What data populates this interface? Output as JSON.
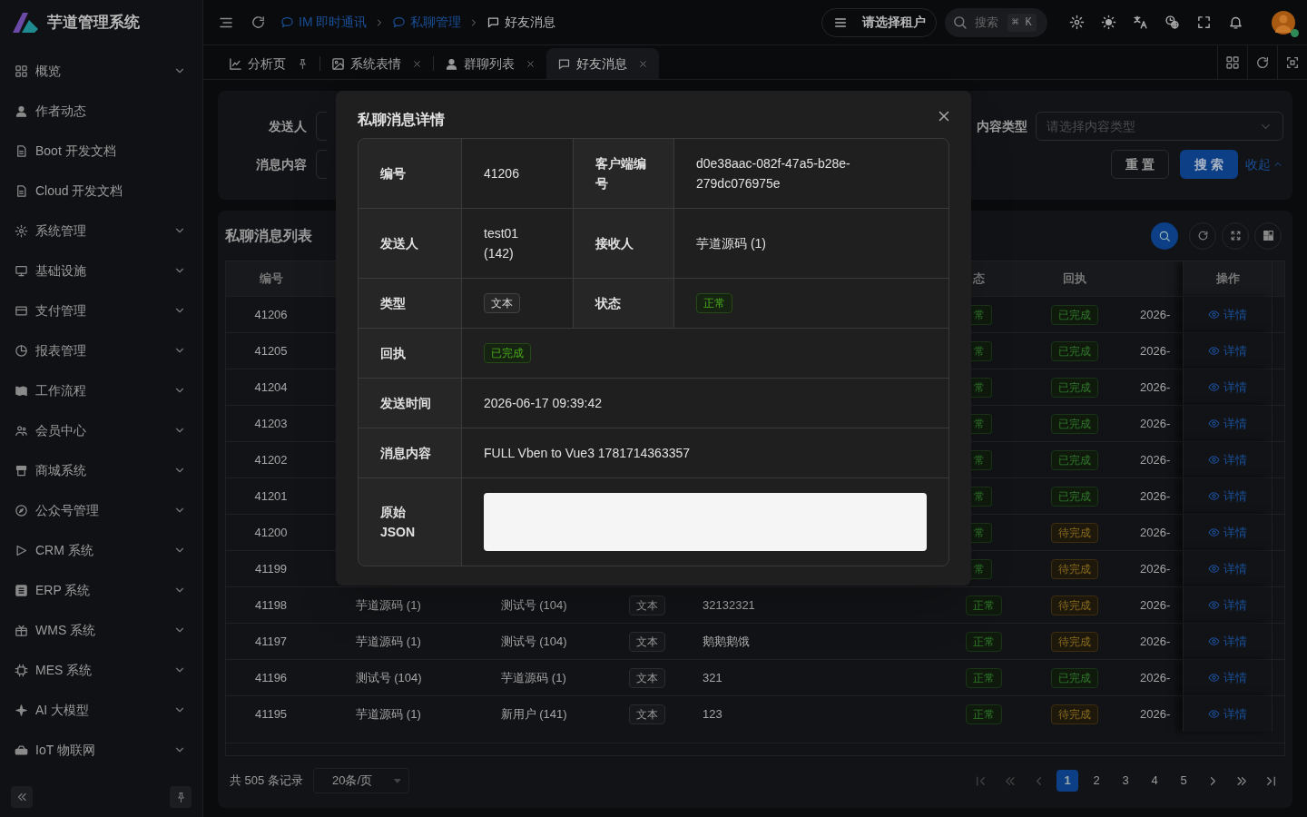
{
  "app": {
    "title": "芋道管理系统"
  },
  "sidebar": {
    "items": [
      {
        "label": "概览",
        "has_children": true
      },
      {
        "label": "作者动态",
        "has_children": false
      },
      {
        "label": "Boot 开发文档",
        "has_children": false
      },
      {
        "label": "Cloud 开发文档",
        "has_children": false
      },
      {
        "label": "系统管理",
        "has_children": true
      },
      {
        "label": "基础设施",
        "has_children": true
      },
      {
        "label": "支付管理",
        "has_children": true
      },
      {
        "label": "报表管理",
        "has_children": true
      },
      {
        "label": "工作流程",
        "has_children": true
      },
      {
        "label": "会员中心",
        "has_children": true
      },
      {
        "label": "商城系统",
        "has_children": true
      },
      {
        "label": "公众号管理",
        "has_children": true
      },
      {
        "label": "CRM 系统",
        "has_children": true
      },
      {
        "label": "ERP 系统",
        "has_children": true
      },
      {
        "label": "WMS 系统",
        "has_children": true
      },
      {
        "label": "MES 系统",
        "has_children": true
      },
      {
        "label": "AI 大模型",
        "has_children": true
      },
      {
        "label": "IoT 物联网",
        "has_children": true
      }
    ]
  },
  "header": {
    "breadcrumb": [
      {
        "label": "IM 即时通讯",
        "current": false
      },
      {
        "label": "私聊管理",
        "current": false
      },
      {
        "label": "好友消息",
        "current": true
      }
    ],
    "tenant_select": {
      "placeholder": "请选择租户"
    },
    "search": {
      "placeholder": "搜索",
      "shortcut": "⌘ K"
    }
  },
  "tabs": [
    {
      "label": "分析页",
      "selected": false,
      "pinned": true
    },
    {
      "label": "系统表情",
      "selected": false,
      "pinned": false
    },
    {
      "label": "群聊列表",
      "selected": false,
      "pinned": false
    },
    {
      "label": "好友消息",
      "selected": true,
      "pinned": false
    }
  ],
  "search_form": {
    "fields": [
      {
        "label": "发送人"
      },
      {
        "label": "消息内容"
      },
      {
        "label": "内容类型",
        "placeholder": "请选择内容类型"
      }
    ],
    "buttons": [
      "重 置",
      "搜 索"
    ],
    "collapse_link": "收起"
  },
  "table": {
    "title": "私聊消息列表",
    "columns": {
      "id": "编号",
      "status": "态",
      "receipt": "回执",
      "action": "操作"
    },
    "rows": [
      {
        "id": "41206",
        "status": {
          "text": "常",
          "kind": "success",
          "clipped": true
        },
        "receipt": {
          "text": "已完成",
          "kind": "success"
        },
        "time": "2026-",
        "action": "详情"
      },
      {
        "id": "41205",
        "status": {
          "text": "常",
          "kind": "success",
          "clipped": true
        },
        "receipt": {
          "text": "已完成",
          "kind": "success"
        },
        "time": "2026-",
        "action": "详情"
      },
      {
        "id": "41204",
        "status": {
          "text": "常",
          "kind": "success",
          "clipped": true
        },
        "receipt": {
          "text": "已完成",
          "kind": "success"
        },
        "time": "2026-",
        "action": "详情"
      },
      {
        "id": "41203",
        "status": {
          "text": "常",
          "kind": "success",
          "clipped": true
        },
        "receipt": {
          "text": "已完成",
          "kind": "success"
        },
        "time": "2026-",
        "action": "详情"
      },
      {
        "id": "41202",
        "status": {
          "text": "常",
          "kind": "success",
          "clipped": true
        },
        "receipt": {
          "text": "已完成",
          "kind": "success"
        },
        "time": "2026-",
        "action": "详情"
      },
      {
        "id": "41201",
        "status": {
          "text": "常",
          "kind": "success",
          "clipped": true
        },
        "receipt": {
          "text": "已完成",
          "kind": "success"
        },
        "time": "2026-",
        "action": "详情"
      },
      {
        "id": "41200",
        "status": {
          "text": "常",
          "kind": "success",
          "clipped": true
        },
        "receipt": {
          "text": "待完成",
          "kind": "warning"
        },
        "time": "2026-",
        "action": "详情"
      },
      {
        "id": "41199",
        "status": {
          "text": "常",
          "kind": "success",
          "clipped": true
        },
        "receipt": {
          "text": "待完成",
          "kind": "warning"
        },
        "time": "2026-",
        "action": "详情"
      },
      {
        "id": "41198",
        "sender": "芋道源码 (1)",
        "receiver": "测试号 (104)",
        "type": "文本",
        "content": "32132321",
        "status": {
          "text": "正常",
          "kind": "success",
          "clipped": false
        },
        "receipt": {
          "text": "待完成",
          "kind": "warning"
        },
        "time": "2026-",
        "action": "详情"
      },
      {
        "id": "41197",
        "sender": "芋道源码 (1)",
        "receiver": "测试号 (104)",
        "type": "文本",
        "content": "鹅鹅鹅饿",
        "status": {
          "text": "正常",
          "kind": "success",
          "clipped": false
        },
        "receipt": {
          "text": "待完成",
          "kind": "warning"
        },
        "time": "2026-",
        "action": "详情"
      },
      {
        "id": "41196",
        "sender": "测试号 (104)",
        "receiver": "芋道源码 (1)",
        "type": "文本",
        "content": "321",
        "status": {
          "text": "正常",
          "kind": "success",
          "clipped": false
        },
        "receipt": {
          "text": "已完成",
          "kind": "success"
        },
        "time": "2026-",
        "action": "详情"
      },
      {
        "id": "41195",
        "sender": "芋道源码 (1)",
        "receiver": "新用户 (141)",
        "type": "文本",
        "content": "123",
        "status": {
          "text": "正常",
          "kind": "success",
          "clipped": false
        },
        "receipt": {
          "text": "待完成",
          "kind": "warning"
        },
        "time": "2026-",
        "action": "详情"
      }
    ]
  },
  "pagination": {
    "total": "共 505 条记录",
    "page_size": "20条/页",
    "pages": [
      {
        "label": "1",
        "selected": true
      },
      {
        "label": "2",
        "selected": false
      },
      {
        "label": "3",
        "selected": false
      },
      {
        "label": "4",
        "selected": false
      },
      {
        "label": "5",
        "selected": false
      }
    ]
  },
  "modal": {
    "title": "私聊消息详情",
    "rows": [
      {
        "cells": [
          {
            "label": "编号",
            "kind": "text",
            "value": "41206"
          },
          {
            "label": "客户端编号",
            "kind": "text",
            "value": "d0e38aac-082f-47a5-b28e-279dc076975e"
          }
        ]
      },
      {
        "cells": [
          {
            "label": "发送人",
            "kind": "text",
            "value": "test01 (142)"
          },
          {
            "label": "接收人",
            "kind": "text",
            "value": "芋道源码 (1)"
          }
        ]
      },
      {
        "cells": [
          {
            "label": "类型",
            "kind": "tag",
            "value": "文本"
          },
          {
            "label": "状态",
            "kind": "success_tag",
            "value": "正常"
          }
        ]
      },
      {
        "cells": [
          {
            "label": "回执",
            "kind": "success_tag",
            "value": "已完成"
          }
        ]
      },
      {
        "cells": [
          {
            "label": "发送时间",
            "kind": "text",
            "value": "2026-06-17 09:39:42"
          }
        ]
      },
      {
        "cells": [
          {
            "label": "消息内容",
            "kind": "text",
            "value": "FULL Vben to Vue3 1781714363357"
          }
        ]
      },
      {
        "cells": [
          {
            "label": "原始 JSON",
            "kind": "code"
          }
        ]
      }
    ]
  }
}
